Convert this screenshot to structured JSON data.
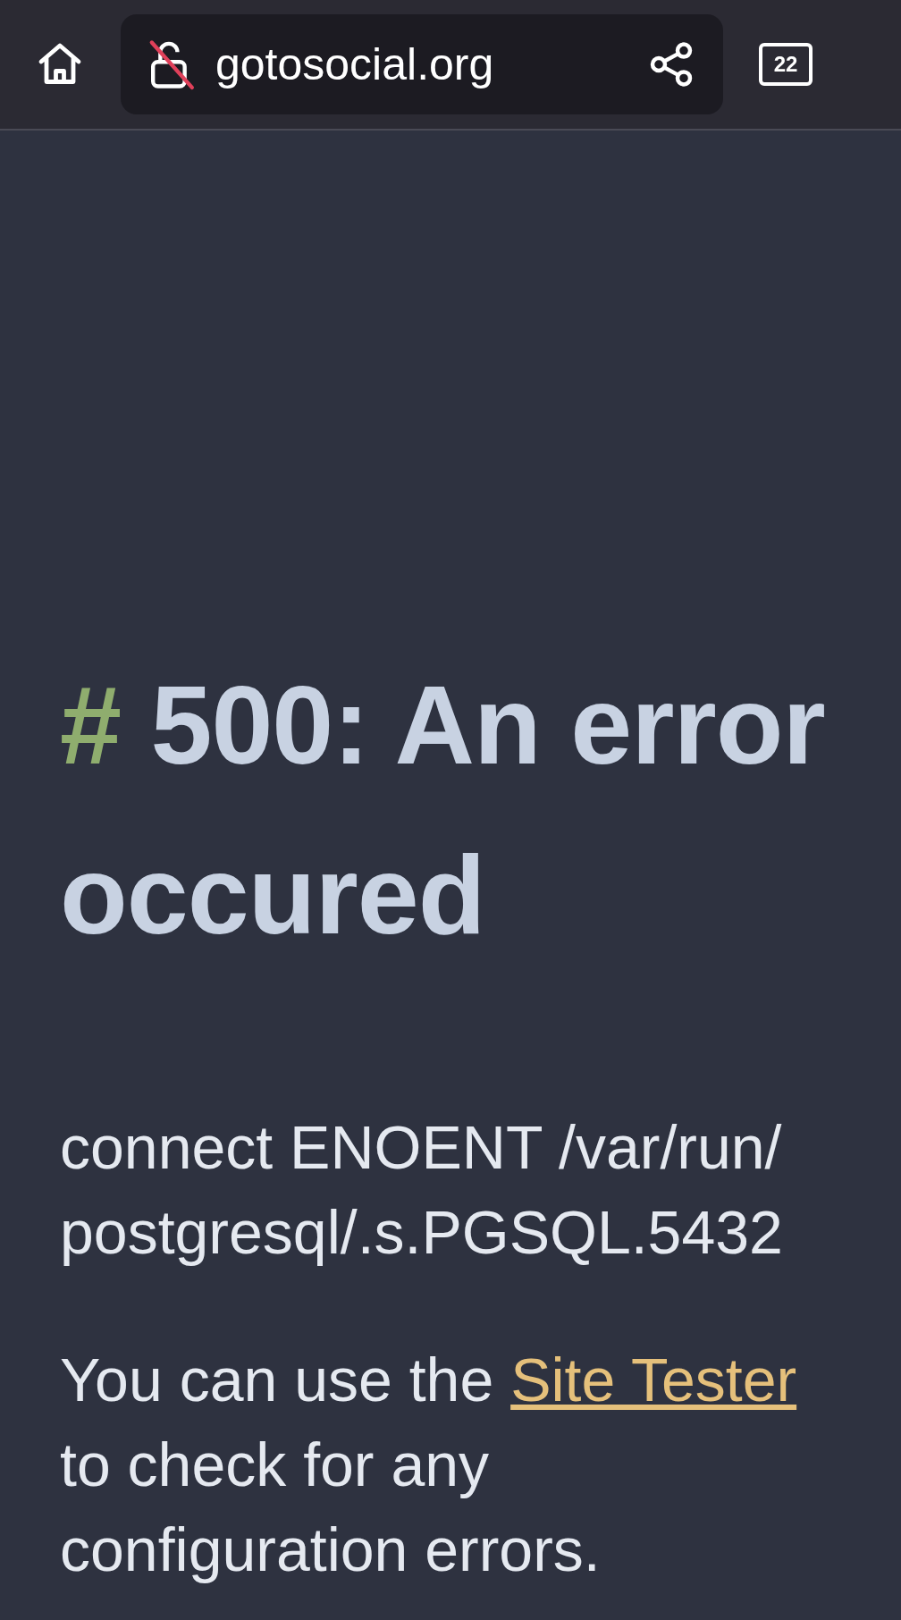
{
  "toolbar": {
    "url": "gotosocial.org",
    "tab_count": "22"
  },
  "page": {
    "heading_mark": "#",
    "heading": "500: An error occured",
    "error_message": "connect ENOENT /var/run/ postgresql/.s.PGSQL.5432",
    "hint": {
      "before": "You can use the",
      "link": "Site Tester",
      "after": "to check for any configuration errors."
    }
  }
}
